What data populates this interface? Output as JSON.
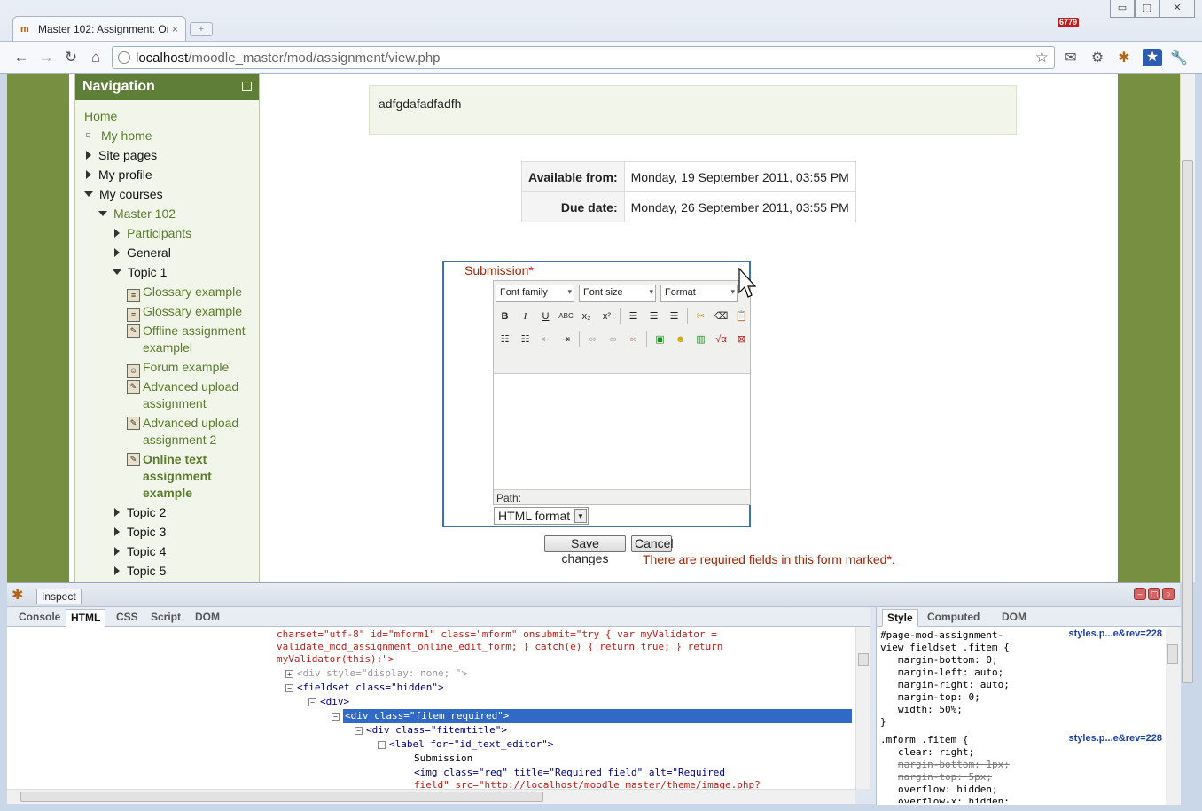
{
  "browser": {
    "tab_title": "Master 102: Assignment: Or",
    "tab_close": "×",
    "new_tab": "+",
    "url_host": "localhost",
    "url_path": "/moodle_master/mod/assignment/view.php",
    "window_min": "▭",
    "window_max": "▢",
    "window_close": "✕",
    "back": "←",
    "forward": "→",
    "reload": "↻",
    "home": "⌂",
    "star": "☆",
    "ext_badge": "6779"
  },
  "navigation": {
    "title": "Navigation",
    "home": "Home",
    "my_home": "My home",
    "site_pages": "Site pages",
    "my_profile": "My profile",
    "my_courses": "My courses",
    "course": "Master 102",
    "participants": "Participants",
    "general": "General",
    "topic1": "Topic 1",
    "activities": [
      "Glossary example",
      "Glossary example",
      "Offline assignment examplel",
      "Forum example",
      "Advanced upload assignment",
      "Advanced upload assignment 2",
      "Online text assignment example"
    ],
    "topic2": "Topic 2",
    "topic3": "Topic 3",
    "topic4": "Topic 4",
    "topic5": "Topic 5"
  },
  "main": {
    "intro_text": "adfgdafadfadfh",
    "available_label": "Available from:",
    "available_value": "Monday, 19 September 2011, 03:55 PM",
    "due_label": "Due date:",
    "due_value": "Monday, 26 September 2011, 03:55 PM",
    "submission_label": "Submission",
    "required_marker": "*",
    "editor": {
      "font_family": "Font family",
      "font_size": "Font size",
      "format": "Format",
      "path_label": "Path:",
      "format_select": "HTML format"
    },
    "save_button": "Save changes",
    "cancel_button": "Cancel",
    "required_note": "There are required fields in this form marked",
    "required_note_end": "."
  },
  "firebug": {
    "inspect": "Inspect",
    "tabs": [
      "Console",
      "HTML",
      "CSS",
      "Script",
      "DOM"
    ],
    "active_tab": "HTML",
    "side_tabs": [
      "Style",
      "Computed",
      "DOM"
    ],
    "active_side_tab": "Style",
    "html_lines": [
      "charset=\"utf-8\" id=\"mform1\" class=\"mform\" onsubmit=\"try { var myValidator =",
      "validate_mod_assignment_online_edit_form; } catch(e) { return true; } return",
      "myValidator(this);\">",
      "<div style=\"display: none; \">",
      "<fieldset class=\"hidden\">",
      "<div>",
      "<div class=\"fitem required\">",
      "<div class=\"fitemtitle\">",
      "<label for=\"id_text_editor\">",
      "Submission",
      "<img class=\"req\" title=\"Required field\" alt=\"Required",
      "field\" src=\"http://localhost/moodle_master/theme/image.php?"
    ],
    "css_rules": [
      {
        "selector_1": "#page-mod-assignment-",
        "selector_2": "view fieldset .fitem {",
        "source": "styles.p...e&rev=228",
        "props": [
          "margin-bottom: 0;",
          "margin-left: auto;",
          "margin-right: auto;",
          "margin-top: 0;",
          "width: 50%;"
        ],
        "close": "}"
      },
      {
        "selector_1": ".mform .fitem {",
        "source": "styles.p...e&rev=228",
        "props": [
          "clear: right;",
          "margin-bottom: 1px;",
          "margin-top: 5px;",
          "overflow: hidden;",
          "overflow-x: hidden;"
        ]
      }
    ]
  }
}
